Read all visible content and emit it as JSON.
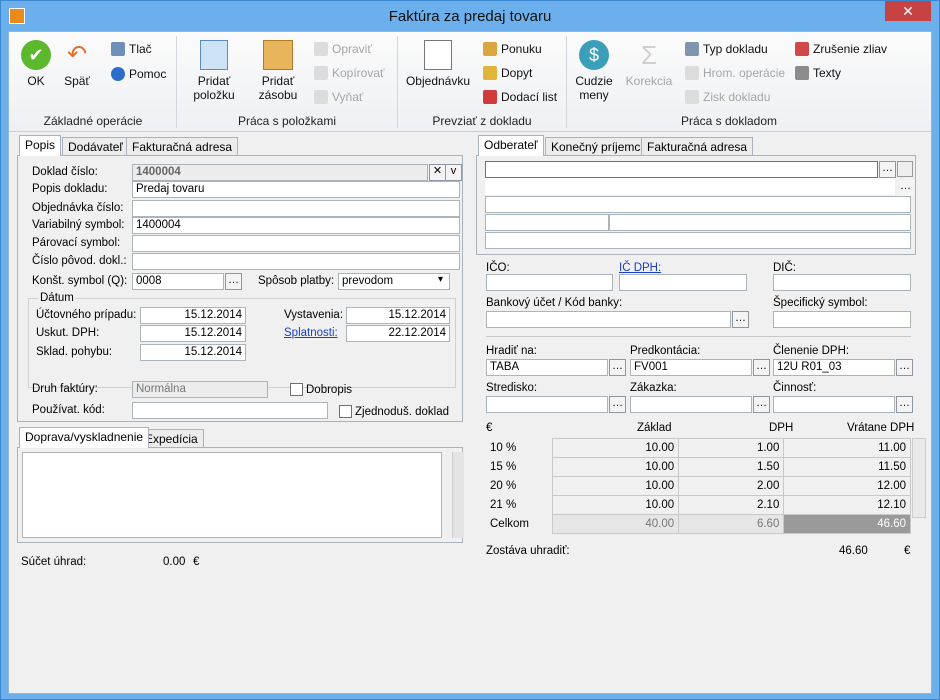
{
  "window": {
    "title": "Faktúra za predaj tovaru"
  },
  "ribbon": {
    "ok": "OK",
    "back": "Späť",
    "print": "Tlač",
    "help": "Pomoc",
    "grp_basic": "Základné operácie",
    "add_item": "Pridať\npoložku",
    "add_stock": "Pridať\nzásobu",
    "edit": "Opraviť",
    "copy": "Kopírovať",
    "cut": "Vyňať",
    "grp_items": "Práca s položkami",
    "order": "Objednávku",
    "offer": "Ponuku",
    "inquiry": "Dopyt",
    "delivery_note": "Dodací list",
    "grp_take": "Prevziať z dokladu",
    "foreign": "Cudzie\nmeny",
    "correction": "Korekcia",
    "doc_type": "Typ dokladu",
    "bulk_ops": "Hrom. operácie",
    "doc_profit": "Zisk dokladu",
    "cancel_disc": "Zrušenie zliav",
    "texts": "Texty",
    "grp_doc": "Práca s dokladom"
  },
  "left_tabs": [
    "Popis",
    "Dodávateľ",
    "Fakturačná adresa"
  ],
  "form": {
    "doc_no_label": "Doklad číslo:",
    "doc_no": "1400004",
    "desc_label": "Popis dokladu:",
    "desc": "Predaj tovaru",
    "order_no_label": "Objednávka číslo:",
    "var_sym_label": "Variabilný symbol:",
    "var_sym": "1400004",
    "pair_sym_label": "Párovací symbol:",
    "orig_doc_label": "Číslo pôvod. dokl.:",
    "const_sym_label": "Konšt. symbol (Q):",
    "const_sym": "0008",
    "pay_label": "Spôsob platby:",
    "pay": "prevodom",
    "date_group": "Dátum",
    "acc_label": "Účtovného prípadu:",
    "acc": "15.12.2014",
    "vat_label": "Uskut. DPH:",
    "vat": "15.12.2014",
    "stock_label": "Sklad. pohybu:",
    "stock": "15.12.2014",
    "issue_label": "Vystavenia:",
    "issue": "15.12.2014",
    "due_label": "Splatnosti:",
    "due": "22.12.2014",
    "inv_type_label": "Druh faktúry:",
    "inv_type": "Normálna",
    "dobropis": "Dobropis",
    "user_code_label": "Používat. kód:",
    "simplified": "Zjednoduš. doklad"
  },
  "bottom_tabs": [
    "Doprava/vyskladnenie",
    "Expedícia"
  ],
  "payments": {
    "label": "Súčet úhrad:",
    "value": "0.00",
    "currency": "€"
  },
  "right_tabs": [
    "Odberateľ",
    "Konečný príjemca",
    "Fakturačná adresa"
  ],
  "right": {
    "ico": "IČO:",
    "icdph": "IČ DPH:",
    "dic": "DIČ:",
    "bank": "Bankový účet / Kód banky:",
    "spec_sym": "Špecifický symbol:",
    "pay_by": "Hradiť na:",
    "pay_by_val": "TABA",
    "precont": "Predkontácia:",
    "precont_val": "FV001",
    "vat_split": "Členenie DPH:",
    "vat_split_val": "12U R01_03",
    "center": "Stredisko:",
    "job": "Zákazka:",
    "activity": "Činnosť:"
  },
  "vat_table": {
    "currency": "€",
    "headers": [
      "Základ",
      "DPH",
      "Vrátane DPH"
    ],
    "rows": [
      [
        "10 %",
        "10.00",
        "1.00",
        "11.00"
      ],
      [
        "15 %",
        "10.00",
        "1.50",
        "11.50"
      ],
      [
        "20 %",
        "10.00",
        "2.00",
        "12.00"
      ],
      [
        "21 %",
        "10.00",
        "2.10",
        "12.10"
      ]
    ],
    "total": [
      "Celkom",
      "40.00",
      "6.60",
      "46.60"
    ]
  },
  "remain": {
    "label": "Zostáva uhradiť:",
    "value": "46.60",
    "currency": "€"
  }
}
